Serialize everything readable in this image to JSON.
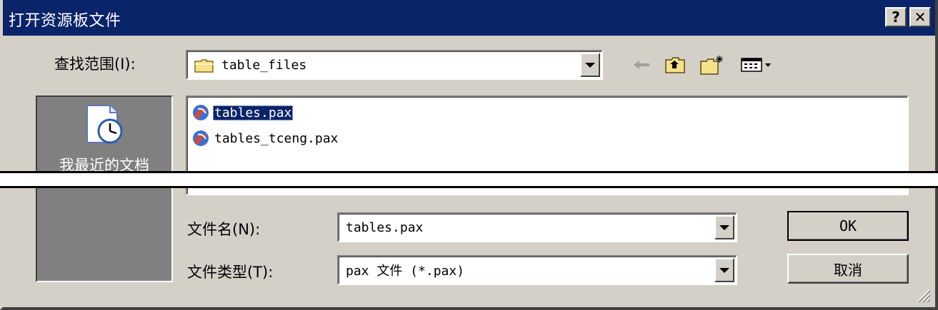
{
  "window": {
    "title": "打开资源板文件",
    "help_label": "?",
    "close_label": "✕"
  },
  "lookin": {
    "label": "查找范围(I):",
    "value": "table_files"
  },
  "places": {
    "recent_label": "我最近的文档"
  },
  "files": [
    {
      "name": "tables.pax",
      "selected": true
    },
    {
      "name": "tables_tceng.pax",
      "selected": false
    }
  ],
  "filename": {
    "label": "文件名(N):",
    "value": "tables.pax"
  },
  "filetype": {
    "label": "文件类型(T):",
    "value": "pax 文件 (*.pax)"
  },
  "buttons": {
    "ok": "OK",
    "cancel": "取消"
  },
  "colors": {
    "titlebar": "#0a246a",
    "face": "#d4d0c8",
    "selection": "#0a246a"
  }
}
